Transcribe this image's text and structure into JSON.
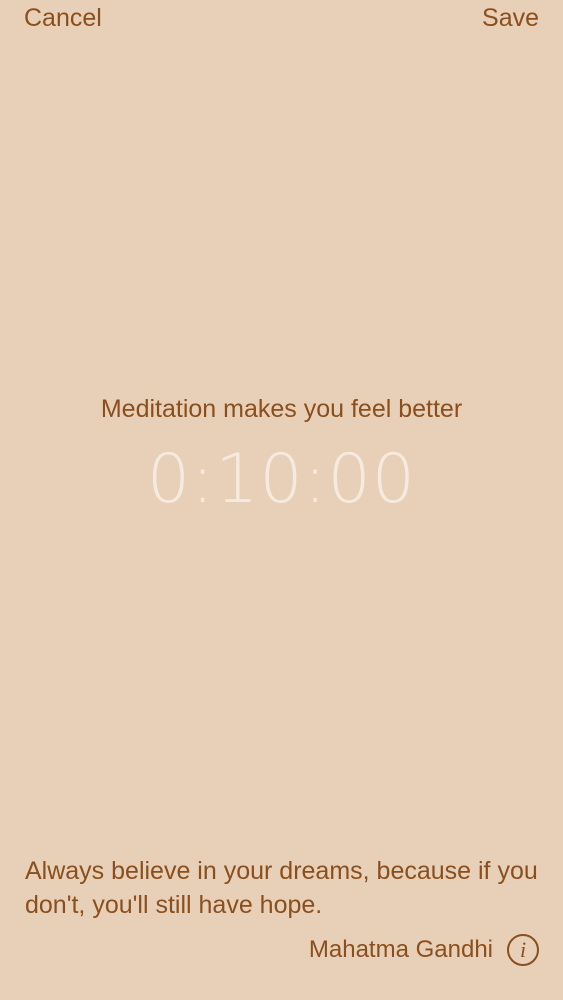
{
  "header": {
    "cancel_label": "Cancel",
    "save_label": "Save"
  },
  "session": {
    "subtitle": "Meditation makes you feel better",
    "timer": "0:10:00"
  },
  "quote": {
    "text": "Always believe in your dreams, because if you don't, you'll still have hope.",
    "author": "Mahatma Gandhi",
    "info_icon": "info-icon"
  },
  "colors": {
    "background": "#e8cfb8",
    "accent": "#8a4f1c",
    "timer": "#f6eae0"
  }
}
